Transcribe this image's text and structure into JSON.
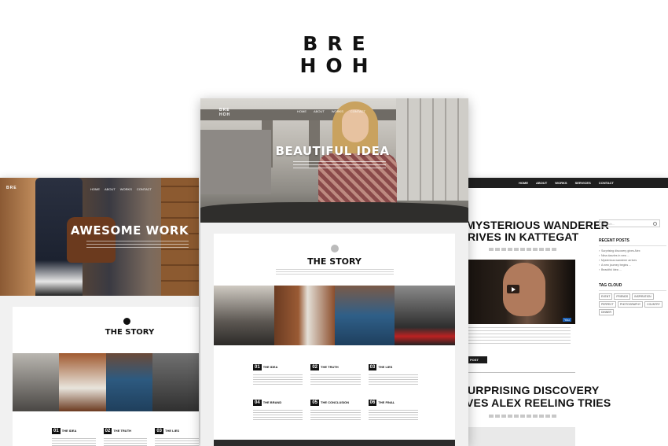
{
  "brand": {
    "line1": "BRE",
    "line2": "HOH"
  },
  "left_panel": {
    "hero_title": "AWESOME WORK",
    "story_title": "THE STORY",
    "items": [
      {
        "num": "01",
        "label": "THE IDEA"
      },
      {
        "num": "02",
        "label": "THE TRUTH"
      },
      {
        "num": "03",
        "label": "THE LIES"
      }
    ]
  },
  "center_panel": {
    "hero_title": "BEAUTIFUL IDEA",
    "story_title": "THE STORY",
    "items": [
      {
        "num": "01",
        "label": "THE IDEA"
      },
      {
        "num": "02",
        "label": "THE TRUTH"
      },
      {
        "num": "03",
        "label": "THE LIES"
      },
      {
        "num": "04",
        "label": "THE BRAND"
      },
      {
        "num": "05",
        "label": "THE CONCLUSION"
      },
      {
        "num": "06",
        "label": "THE FINAL"
      }
    ]
  },
  "right_panel": {
    "nav": [
      "HOME",
      "ABOUT",
      "WORKS",
      "SERVICES",
      "CONTACT"
    ],
    "post1_line1": "MYSTERIOUS WANDERER",
    "post1_line2": "RIVES IN KATTEGAT",
    "post_button": "POST",
    "post2_line1": "URPRISING DISCOVERY",
    "post2_line2": "VES ALEX REELING TRIES",
    "sidebar": {
      "recent_posts_title": "RECENT POSTS",
      "tag_cloud_title": "TAG CLOUD"
    }
  },
  "colors": {
    "dark": "#111111",
    "panel_bg": "#f1f1f1"
  }
}
